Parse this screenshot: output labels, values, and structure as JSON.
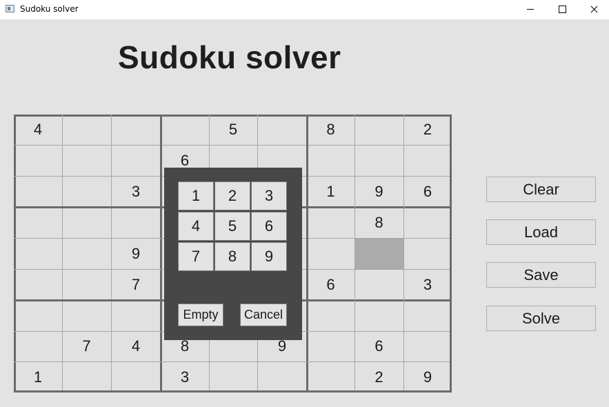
{
  "window": {
    "title": "Sudoku solver"
  },
  "page": {
    "heading": "Sudoku solver"
  },
  "board": {
    "cells": [
      [
        "4",
        "",
        "",
        "",
        "5",
        "",
        "8",
        "",
        "2"
      ],
      [
        "",
        "",
        "",
        "6",
        "",
        "",
        "",
        "",
        ""
      ],
      [
        "",
        "",
        "3",
        "",
        "",
        "",
        "1",
        "9",
        "6"
      ],
      [
        "",
        "",
        "",
        "",
        "",
        "",
        "",
        "8",
        ""
      ],
      [
        "",
        "",
        "9",
        "",
        "",
        "",
        "",
        "",
        ""
      ],
      [
        "",
        "",
        "7",
        "",
        "",
        "",
        "6",
        "",
        "3"
      ],
      [
        "",
        "",
        "",
        "",
        "",
        "",
        "",
        "",
        ""
      ],
      [
        "",
        "7",
        "4",
        "8",
        "",
        "9",
        "",
        "6",
        ""
      ],
      [
        "1",
        "",
        "",
        "3",
        "",
        "",
        "",
        "2",
        "9"
      ]
    ],
    "selected": {
      "row": 4,
      "col": 7
    }
  },
  "popup": {
    "digits": [
      "1",
      "2",
      "3",
      "4",
      "5",
      "6",
      "7",
      "8",
      "9"
    ],
    "empty_label": "Empty",
    "cancel_label": "Cancel"
  },
  "actions": {
    "clear_label": "Clear",
    "load_label": "Load",
    "save_label": "Save",
    "solve_label": "Solve"
  },
  "colors": {
    "background": "#e3e3e3",
    "selected_cell": "#ababab",
    "popup_bg": "#474747",
    "block_border": "#6a6a6a"
  }
}
